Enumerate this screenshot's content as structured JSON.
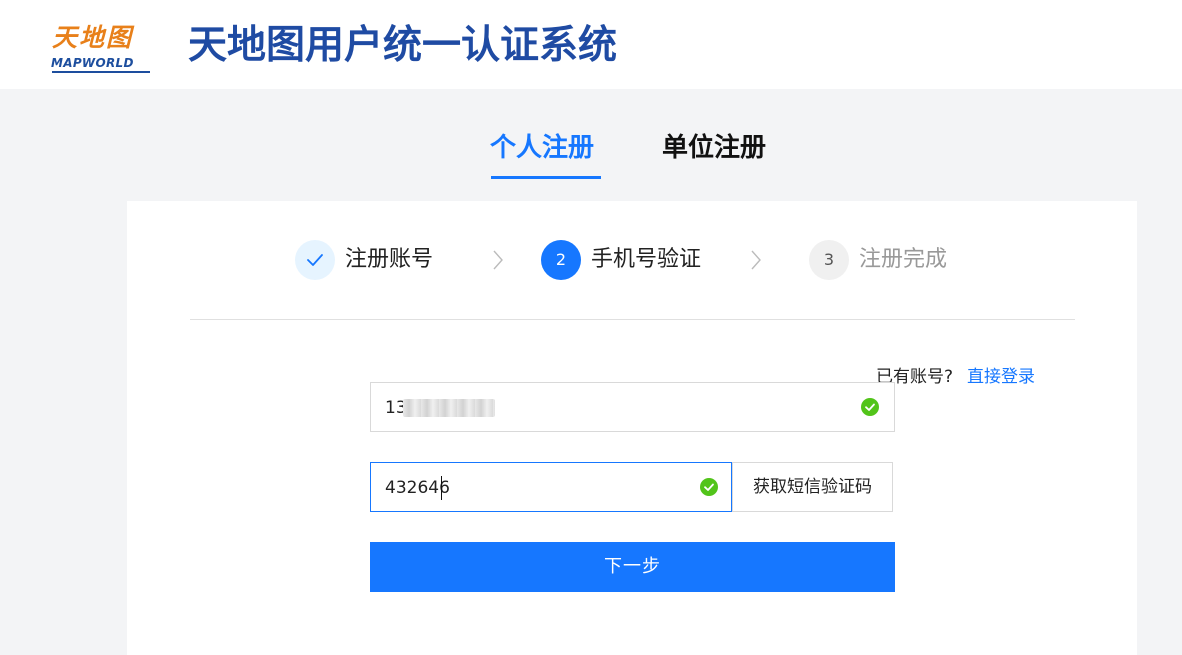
{
  "header": {
    "logo_text_cn": "天地图",
    "logo_text_en": "MAPWORLD",
    "title": "天地图用户统一认证系统"
  },
  "tabs": [
    {
      "label": "个人注册",
      "active": true
    },
    {
      "label": "单位注册",
      "active": false
    }
  ],
  "steps": [
    {
      "number": "✓",
      "label": "注册账号",
      "state": "done"
    },
    {
      "number": "2",
      "label": "手机号验证",
      "state": "active"
    },
    {
      "number": "3",
      "label": "注册完成",
      "state": "pending"
    }
  ],
  "login_prompt": {
    "text": "已有账号?",
    "link": "直接登录"
  },
  "form": {
    "phone_value": "13",
    "code_value": "432646",
    "sms_button_label": "获取短信验证码",
    "next_button_label": "下一步"
  },
  "colors": {
    "primary": "#1677ff",
    "title": "#1f4ba3",
    "success": "#52c41a",
    "logo_orange": "#e8801a"
  }
}
